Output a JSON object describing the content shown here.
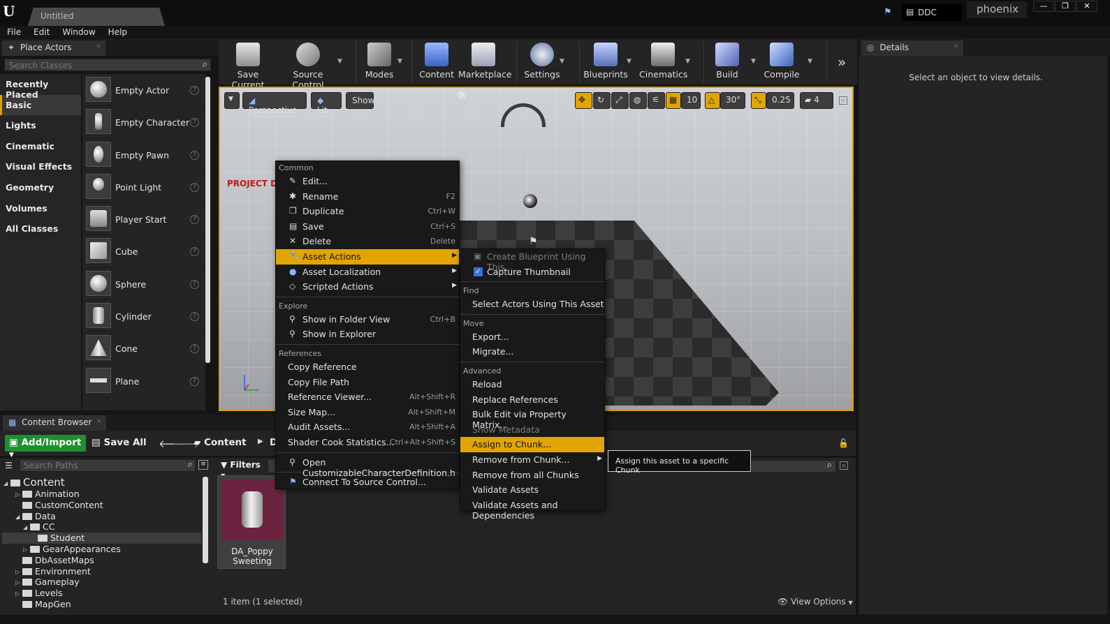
{
  "window": {
    "tab_title": "Untitled",
    "ddc_label": "DDC",
    "user": "phoenix",
    "window_controls": [
      "—",
      "❐",
      "✕"
    ]
  },
  "menubar": [
    "File",
    "Edit",
    "Window",
    "Help"
  ],
  "place_actors": {
    "tab_label": "Place Actors",
    "search_placeholder": "Search Classes",
    "categories": [
      "Recently Placed",
      "Basic",
      "Lights",
      "Cinematic",
      "Visual Effects",
      "Geometry",
      "Volumes",
      "All Classes"
    ],
    "selected_category": "Basic",
    "actors": [
      "Empty Actor",
      "Empty Character",
      "Empty Pawn",
      "Point Light",
      "Player Start",
      "Cube",
      "Sphere",
      "Cylinder",
      "Cone",
      "Plane"
    ]
  },
  "toolbar": {
    "buttons": [
      "Save Current",
      "Source Control",
      "Modes",
      "Content",
      "Marketplace",
      "Settings",
      "Blueprints",
      "Cinematics",
      "Build",
      "Compile"
    ]
  },
  "viewport": {
    "perspective_label": "Perspective",
    "lit_label": "Lit",
    "show_label": "Show",
    "grid_snap": "10",
    "rotation_snap": "30°",
    "scale_snap": "0.25",
    "camera_speed": "4",
    "overlay_text": "PROJECT D"
  },
  "context_menu": {
    "sections": {
      "common": "Common",
      "explore": "Explore",
      "references": "References"
    },
    "common_items": [
      {
        "label": "Edit...",
        "shortcut": ""
      },
      {
        "label": "Rename",
        "shortcut": "F2"
      },
      {
        "label": "Duplicate",
        "shortcut": "Ctrl+W"
      },
      {
        "label": "Save",
        "shortcut": "Ctrl+S"
      },
      {
        "label": "Delete",
        "shortcut": "Delete"
      },
      {
        "label": "Asset Actions",
        "shortcut": ""
      },
      {
        "label": "Asset Localization",
        "shortcut": ""
      },
      {
        "label": "Scripted Actions",
        "shortcut": ""
      }
    ],
    "explore_items": [
      {
        "label": "Show in Folder View",
        "shortcut": "Ctrl+B"
      },
      {
        "label": "Show in Explorer",
        "shortcut": ""
      }
    ],
    "reference_items": [
      {
        "label": "Copy Reference",
        "shortcut": ""
      },
      {
        "label": "Copy File Path",
        "shortcut": ""
      },
      {
        "label": "Reference Viewer...",
        "shortcut": "Alt+Shift+R"
      },
      {
        "label": "Size Map...",
        "shortcut": "Alt+Shift+M"
      },
      {
        "label": "Audit Assets...",
        "shortcut": "Alt+Shift+A"
      },
      {
        "label": "Shader Cook Statistics...",
        "shortcut": "Ctrl+Alt+Shift+S"
      }
    ],
    "open_item": "Open CustomizableCharacterDefinition.h",
    "source_control_item": "Connect To Source Control..."
  },
  "submenu": {
    "top_items": [
      "Create Blueprint Using This...",
      "Capture Thumbnail"
    ],
    "find_header": "Find",
    "find_items": [
      "Select Actors Using This Asset"
    ],
    "move_header": "Move",
    "move_items": [
      "Export...",
      "Migrate..."
    ],
    "advanced_header": "Advanced",
    "advanced_items": [
      "Reload",
      "Replace References",
      "Bulk Edit via Property Matrix...",
      "Show Metadata",
      "Assign to Chunk...",
      "Remove from Chunk...",
      "Remove from all Chunks",
      "Validate Assets",
      "Validate Assets and Dependencies"
    ]
  },
  "tooltip": "Assign this asset to a specific Chunk",
  "details": {
    "tab_label": "Details",
    "empty_message": "Select an object to view details."
  },
  "content_browser": {
    "tab_label": "Content Browser",
    "add_import": "Add/Import",
    "save_all": "Save All",
    "path_root": "Content",
    "path_next": "D",
    "search_paths_placeholder": "Search Paths",
    "filters_label": "Filters",
    "tree": [
      {
        "label": "Content",
        "depth": 0,
        "root": true
      },
      {
        "label": "Animation",
        "depth": 1
      },
      {
        "label": "CustomContent",
        "depth": 1
      },
      {
        "label": "Data",
        "depth": 1,
        "open": true
      },
      {
        "label": "CC",
        "depth": 2,
        "open": true
      },
      {
        "label": "Student",
        "depth": 3,
        "selected": true
      },
      {
        "label": "GearAppearances",
        "depth": 2
      },
      {
        "label": "DbAssetMaps",
        "depth": 1
      },
      {
        "label": "Environment",
        "depth": 1
      },
      {
        "label": "Gameplay",
        "depth": 1
      },
      {
        "label": "Levels",
        "depth": 1
      },
      {
        "label": "MapGen",
        "depth": 1
      }
    ],
    "asset_name_line1": "DA_Poppy",
    "asset_name_line2": "Sweeting",
    "status": "1 item (1 selected)",
    "view_options": "View Options"
  }
}
